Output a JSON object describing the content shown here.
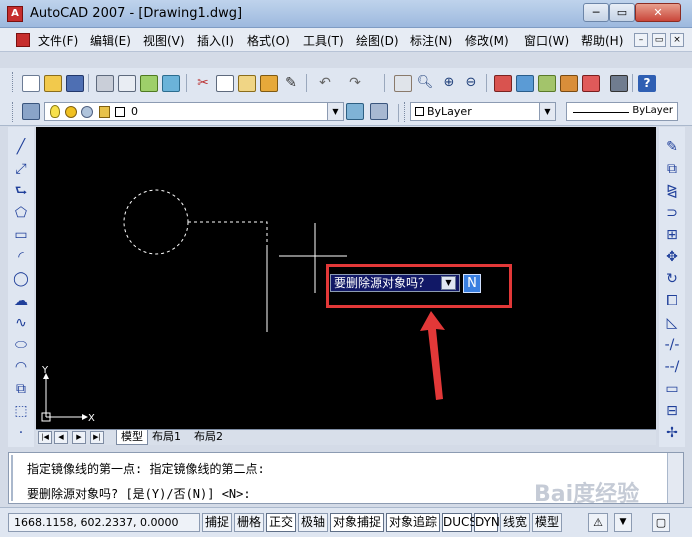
{
  "window": {
    "title": "AutoCAD 2007 - [Drawing1.dwg]",
    "min_glyph": "─",
    "max_glyph": "▭",
    "close_glyph": "✕"
  },
  "menu": {
    "items": [
      "文件(F)",
      "编辑(E)",
      "视图(V)",
      "插入(I)",
      "格式(O)",
      "工具(T)",
      "绘图(D)",
      "标注(N)",
      "修改(M)",
      "窗口(W)",
      "帮助(H)"
    ],
    "mdi_min": "–",
    "mdi_close": "×"
  },
  "layers": {
    "current_layer": "0",
    "color": "ByLayer",
    "linetype": "ByLayer"
  },
  "dynamic_input": {
    "prompt": "要删除源对象吗？",
    "value": "N"
  },
  "tabs": {
    "nav": [
      "|◀",
      "◀",
      "▶",
      "▶|"
    ],
    "items": [
      "模型",
      "布局1",
      "布局2"
    ]
  },
  "ucs": {
    "x_label": "X",
    "y_label": "Y"
  },
  "command": {
    "line1": "指定镜像线的第一点: 指定镜像线的第二点:",
    "line2": "要删除源对象吗? [是(Y)/否(N)] <N>:"
  },
  "status": {
    "coordinates": "1668.1158, 602.2337, 0.0000",
    "buttons": [
      "捕捉",
      "栅格",
      "正交",
      "极轴",
      "对象捕捉",
      "对象追踪",
      "DUCS",
      "DYN",
      "线宽",
      "模型"
    ],
    "active_buttons": [
      "正交",
      "对象捕捉",
      "对象追踪",
      "DUCS",
      "DYN"
    ]
  },
  "watermark": "Bai度经验",
  "colors": {
    "canvas": "#000000",
    "highlight": "#e23838",
    "dyn_prompt_bg": "#111866",
    "dyn_field_bg": "#3a7fe0"
  },
  "icons": {
    "standard_toolbar": [
      "new-icon",
      "open-icon",
      "save-icon",
      "print-icon",
      "preview-icon",
      "publish-icon",
      "3d-dwf-icon",
      "cut-icon",
      "copy-icon",
      "paste-icon",
      "match-properties-icon",
      "block-editor-icon",
      "undo-icon",
      "redo-icon",
      "pan-icon",
      "zoom-realtime-icon",
      "zoom-window-icon",
      "zoom-previous-icon",
      "properties-icon",
      "design-center-icon",
      "tool-palettes-icon",
      "sheet-set-icon",
      "markup-icon",
      "calculator-icon",
      "help-icon"
    ],
    "layer_toolbar": [
      "layer-manager-icon",
      "light-bulb-icon",
      "sun-icon",
      "lock-icon",
      "color-swatch-icon",
      "make-current-icon",
      "layer-previous-icon"
    ],
    "draw_toolbar": [
      "line-icon",
      "construction-line-icon",
      "polyline-icon",
      "polygon-icon",
      "rectangle-icon",
      "arc-icon",
      "circle-icon",
      "revision-cloud-icon",
      "spline-icon",
      "ellipse-icon",
      "ellipse-arc-icon",
      "insert-block-icon",
      "make-block-icon",
      "point-icon"
    ],
    "modify_toolbar": [
      "erase-icon",
      "copy-object-icon",
      "mirror-icon",
      "offset-icon",
      "array-icon",
      "move-icon",
      "rotate-icon",
      "scale-icon",
      "stretch-icon",
      "trim-icon",
      "extend-icon",
      "break-icon",
      "join-icon",
      "chamfer-icon",
      "explode-icon"
    ]
  }
}
